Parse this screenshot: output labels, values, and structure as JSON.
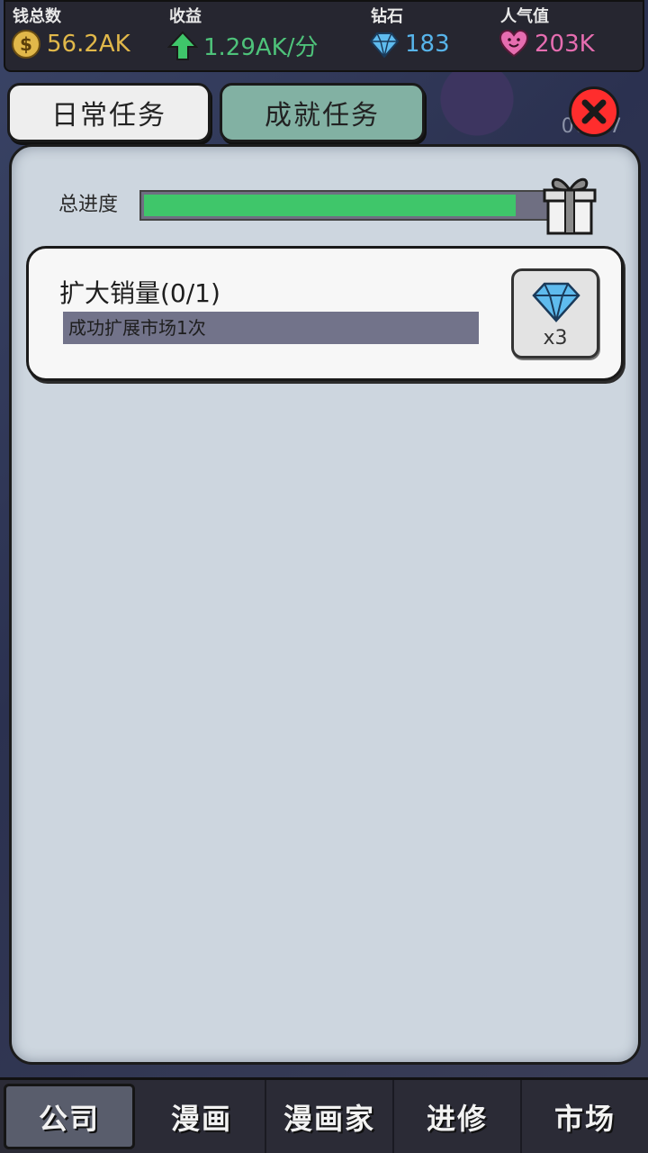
{
  "stats": {
    "money": {
      "label": "钱总数",
      "value": "56.2AK",
      "icon": "coin-icon",
      "color": "#e1b84a"
    },
    "income": {
      "label": "收益",
      "value": "1.29AK/分",
      "icon": "arrow-up-icon",
      "color": "#4ec27a"
    },
    "diamond": {
      "label": "钻石",
      "value": "183",
      "icon": "diamond-icon",
      "color": "#57b4ea"
    },
    "fame": {
      "label": "人气值",
      "value": "203K",
      "icon": "heart-face-icon",
      "color": "#e66db0"
    }
  },
  "scene": {
    "timer": "00:17"
  },
  "tabs": [
    {
      "label": "日常任务",
      "active": false
    },
    {
      "label": "成就任务",
      "active": true
    }
  ],
  "overall_progress": {
    "label": "总进度",
    "fraction": 0.9,
    "reward_icon": "gift-icon"
  },
  "tasks": [
    {
      "title": "扩大销量(0/1)",
      "description": "成功扩展市场1次",
      "reward_icon": "diamond-icon",
      "reward_count": "x3"
    }
  ],
  "nav": [
    {
      "label": "公司",
      "active": true
    },
    {
      "label": "漫画",
      "active": false
    },
    {
      "label": "漫画家",
      "active": false
    },
    {
      "label": "进修",
      "active": false
    },
    {
      "label": "市场",
      "active": false
    }
  ]
}
